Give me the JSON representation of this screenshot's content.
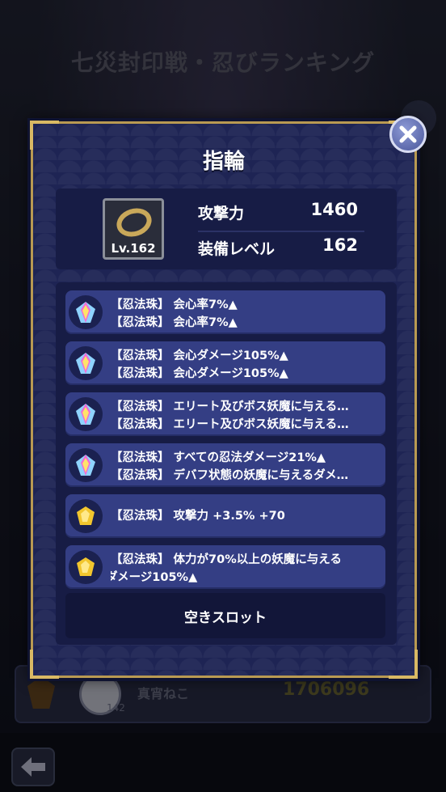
{
  "background": {
    "title": "七災封印戦・忍びランキング",
    "ranking_row": {
      "name": "真宵ねこ",
      "level": "142",
      "score": "1706096"
    }
  },
  "modal": {
    "title": "指輪",
    "equipment": {
      "level_badge": "Lv.162",
      "stats": [
        {
          "label": "攻撃力",
          "value": "1460"
        },
        {
          "label": "装備レベル",
          "value": "162"
        }
      ]
    },
    "slots": [
      {
        "gem": "rainbow-gem-icon",
        "lines": [
          "【忍法珠】 会心率7%▲",
          "【忍法珠】 会心率7%▲"
        ]
      },
      {
        "gem": "rainbow-gem-icon",
        "lines": [
          "【忍法珠】 会心ダメージ105%▲",
          "【忍法珠】 会心ダメージ105%▲"
        ]
      },
      {
        "gem": "rainbow-gem-icon",
        "lines": [
          "【忍法珠】 エリート及びボス妖魔に与える…",
          "【忍法珠】 エリート及びボス妖魔に与える…"
        ]
      },
      {
        "gem": "rainbow-gem-icon",
        "lines": [
          "【忍法珠】 すべての忍法ダメージ21%▲",
          "【忍法珠】 デバフ状態の妖魔に与えるダメ…"
        ]
      },
      {
        "gem": "gold-gem-icon",
        "lines": [
          "【忍法珠】 攻撃力 +3.5% +70"
        ]
      },
      {
        "gem": "gold-gem-icon",
        "lines": [
          "【忍法珠】 体力が70%以上の妖魔に与える",
          "ダメージ105%▲"
        ]
      }
    ],
    "empty_slot_label": "空きスロット"
  },
  "colors": {
    "modal_bg": "#1e2454",
    "frame_gold": "#b99a52",
    "slot_bg": "#343e84"
  }
}
